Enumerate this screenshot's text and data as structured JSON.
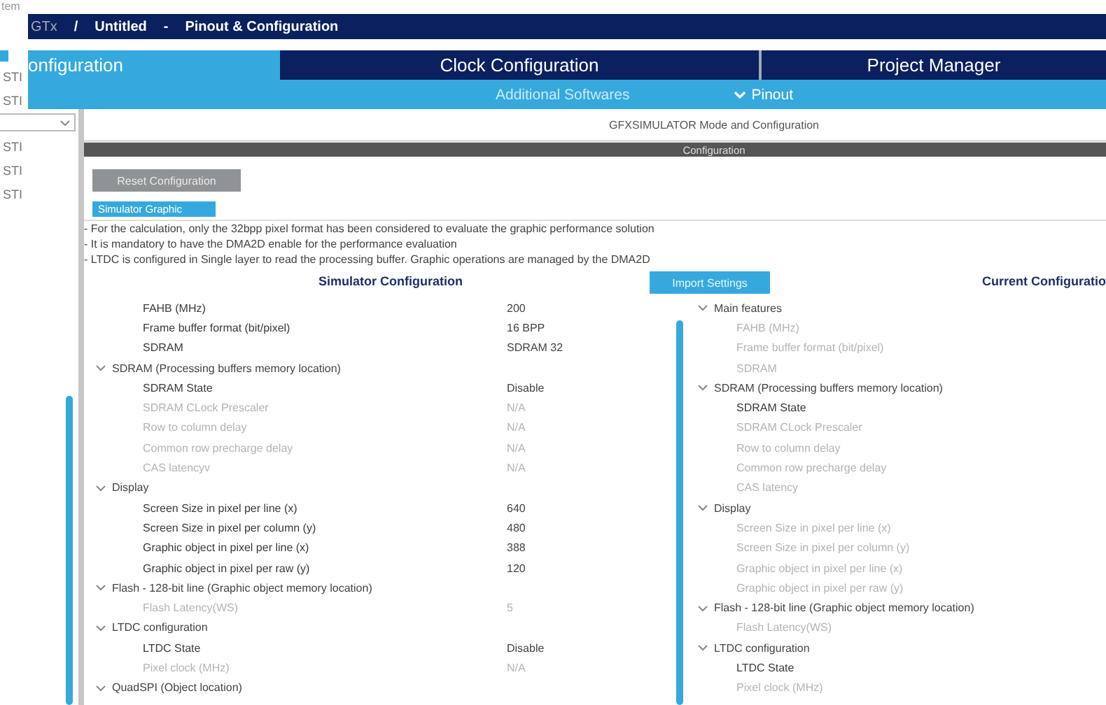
{
  "corner_text": "tem",
  "sidebar": {
    "items": [
      {
        "label": "STI"
      },
      {
        "label": "STI"
      },
      {
        "label": "STI"
      },
      {
        "label": "STI"
      },
      {
        "label": "STI"
      }
    ]
  },
  "title_bar": {
    "segments": [
      "GTx",
      "/",
      "Untitled",
      "-",
      "Pinout & Configuration"
    ]
  },
  "tabs": [
    {
      "label": "onfiguration",
      "selected": true
    },
    {
      "label": "Clock Configuration",
      "selected": false
    },
    {
      "label": "Project Manager",
      "selected": false
    }
  ],
  "sub_tabs": [
    {
      "label": "Additional Softwares",
      "kind": "plain"
    },
    {
      "label": "Pinout",
      "kind": "dropdown"
    }
  ],
  "mode_title": "GFXSIMULATOR Mode and Configuration",
  "section_bar": "Configuration",
  "reset_button": "Reset Configuration",
  "panel_tab": {
    "label": "Simulator Graphic",
    "selected": true
  },
  "notes": [
    "- For the calculation, only the 32bpp pixel format has been considered to evaluate the graphic performance solution",
    "- It is mandatory to have the DMA2D enable for the performance evaluation",
    "- LTDC is configured in Single layer to read the processing buffer. Graphic operations are managed by the DMA2D"
  ],
  "import_button": "Import Settings",
  "simulator": {
    "heading": "Simulator Configuration",
    "tree": [
      {
        "kind": "param",
        "label": "FAHB (MHz)",
        "value": "200",
        "disabled": false
      },
      {
        "kind": "param",
        "label": "Frame buffer format (bit/pixel)",
        "value": "16 BPP",
        "disabled": false
      },
      {
        "kind": "param",
        "label": "SDRAM",
        "value": "SDRAM 32",
        "disabled": false
      },
      {
        "kind": "group",
        "label": "SDRAM (Processing buffers memory location)",
        "expanded": true,
        "children": [
          {
            "kind": "param",
            "label": "SDRAM State",
            "value": "Disable",
            "disabled": false
          },
          {
            "kind": "param",
            "label": "SDRAM CLock Prescaler",
            "value": "N/A",
            "disabled": true
          },
          {
            "kind": "param",
            "label": "Row to column delay",
            "value": "N/A",
            "disabled": true
          },
          {
            "kind": "param",
            "label": "Common row precharge delay",
            "value": "N/A",
            "disabled": true
          },
          {
            "kind": "param",
            "label": "CAS latencyv",
            "value": "N/A",
            "disabled": true
          }
        ]
      },
      {
        "kind": "group",
        "label": "Display",
        "expanded": true,
        "children": [
          {
            "kind": "param",
            "label": "Screen Size in pixel per line (x)",
            "value": "640",
            "disabled": false
          },
          {
            "kind": "param",
            "label": "Screen Size in pixel per column (y)",
            "value": "480",
            "disabled": false
          },
          {
            "kind": "param",
            "label": "Graphic object in pixel per line (x)",
            "value": "388",
            "disabled": false
          },
          {
            "kind": "param",
            "label": "Graphic object in pixel per raw (y)",
            "value": "120",
            "disabled": false
          }
        ]
      },
      {
        "kind": "group",
        "label": "Flash - 128-bit line (Graphic object memory location)",
        "expanded": true,
        "children": [
          {
            "kind": "param",
            "label": "Flash Latency(WS)",
            "value": "5",
            "disabled": true
          }
        ]
      },
      {
        "kind": "group",
        "label": "LTDC configuration",
        "expanded": true,
        "children": [
          {
            "kind": "param",
            "label": "LTDC State",
            "value": "Disable",
            "disabled": false
          },
          {
            "kind": "param",
            "label": "Pixel clock (MHz)",
            "value": "N/A",
            "disabled": true
          }
        ]
      },
      {
        "kind": "group",
        "label": "QuadSPI (Object location)",
        "expanded": true
      }
    ]
  },
  "current": {
    "heading": "Current Configuratio",
    "tree": [
      {
        "kind": "group",
        "label": "Main features",
        "expanded": true,
        "children": [
          {
            "kind": "param",
            "label": "FAHB (MHz)",
            "disabled": true
          },
          {
            "kind": "param",
            "label": "Frame buffer format (bit/pixel)",
            "disabled": true
          },
          {
            "kind": "param",
            "label": "SDRAM",
            "disabled": true
          }
        ]
      },
      {
        "kind": "group",
        "label": "SDRAM (Processing buffers memory location)",
        "expanded": true,
        "children": [
          {
            "kind": "param",
            "label": "SDRAM State",
            "disabled": false
          },
          {
            "kind": "param",
            "label": "SDRAM CLock Prescaler",
            "disabled": true
          },
          {
            "kind": "param",
            "label": "Row to column delay",
            "disabled": true
          },
          {
            "kind": "param",
            "label": "Common row precharge delay",
            "disabled": true
          },
          {
            "kind": "param",
            "label": "CAS latency",
            "disabled": true
          }
        ]
      },
      {
        "kind": "group",
        "label": "Display",
        "expanded": true,
        "children": [
          {
            "kind": "param",
            "label": "Screen Size in pixel per line (x)",
            "disabled": true
          },
          {
            "kind": "param",
            "label": "Screen Size in pixel per column (y)",
            "disabled": true
          },
          {
            "kind": "param",
            "label": "Graphic object in pixel per line (x)",
            "disabled": true
          },
          {
            "kind": "param",
            "label": "Graphic object in pixel per raw (y)",
            "disabled": true
          }
        ]
      },
      {
        "kind": "group",
        "label": "Flash - 128-bit line (Graphic object memory location)",
        "expanded": true,
        "children": [
          {
            "kind": "param",
            "label": "Flash Latency(WS)",
            "disabled": true
          }
        ]
      },
      {
        "kind": "group",
        "label": "LTDC configuration",
        "expanded": true,
        "children": [
          {
            "kind": "param",
            "label": "LTDC State",
            "disabled": false
          },
          {
            "kind": "param",
            "label": "Pixel clock (MHz)",
            "disabled": true
          }
        ]
      }
    ]
  }
}
